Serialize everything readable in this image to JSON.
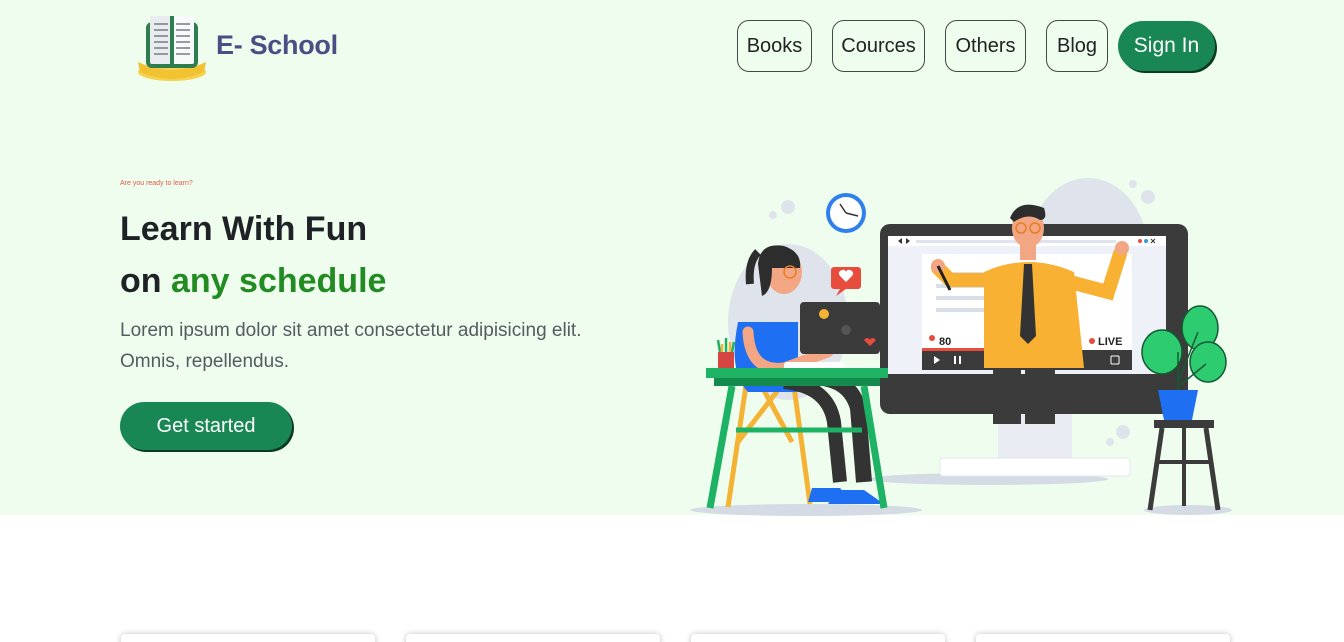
{
  "brand": {
    "name": "E- School",
    "logo_icon": "open-book-icon"
  },
  "nav": {
    "items": [
      {
        "label": "Books"
      },
      {
        "label": "Cources"
      },
      {
        "label": "Others"
      },
      {
        "label": "Blog"
      }
    ],
    "signin_label": "Sign In"
  },
  "hero": {
    "eyebrow": "Are you ready to learn?",
    "title_line1": "Learn With Fun",
    "title_line2_prefix": "on",
    "title_line2_accent": "any schedule",
    "paragraph": "Lorem ipsum dolor sit amet consectetur adipisicing elit. Omnis, repellendus.",
    "cta_label": "Get started",
    "illustration": {
      "viewer_count": "80",
      "live_label": "LIVE"
    }
  },
  "colors": {
    "hero_background": "#effdee",
    "primary_green": "#198754",
    "accent_green": "#228b22",
    "brand_text": "#4a4e84",
    "eyebrow_red": "#e05a4a"
  }
}
